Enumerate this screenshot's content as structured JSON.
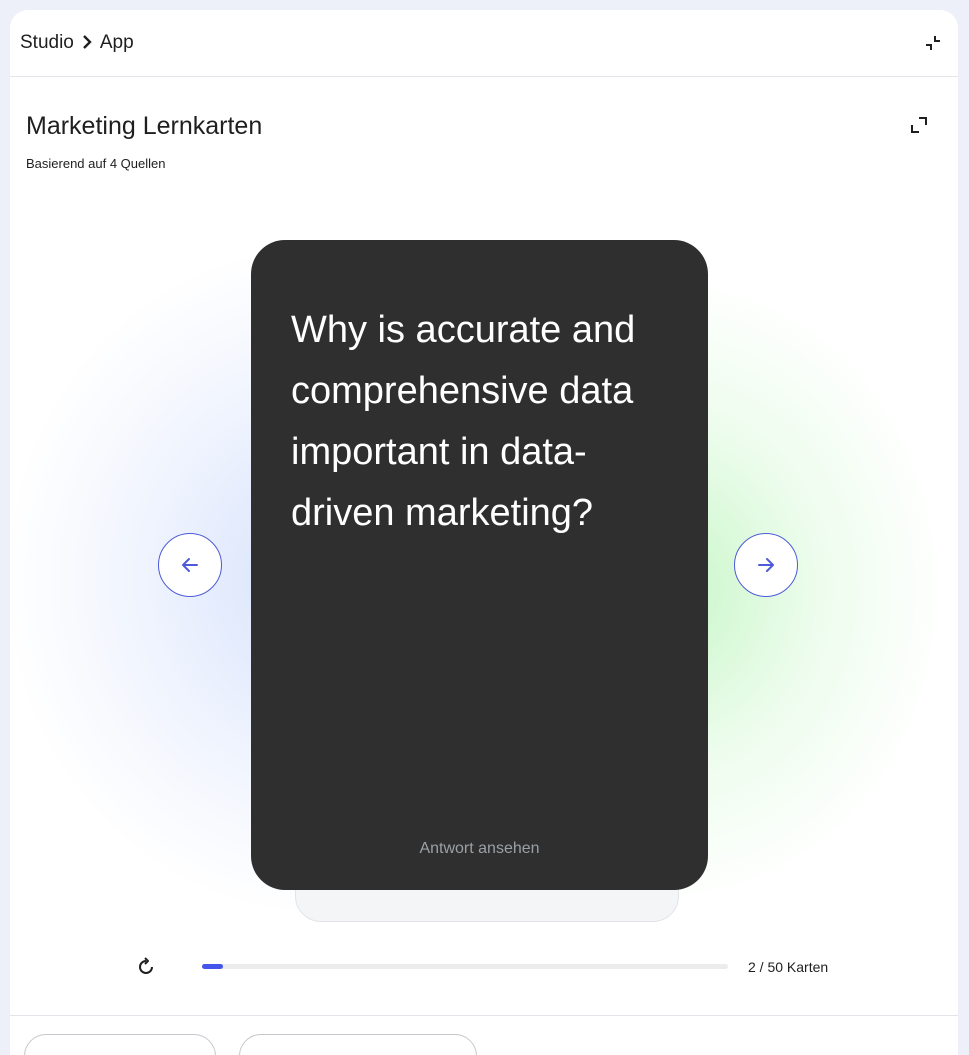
{
  "breadcrumb": {
    "studio": "Studio",
    "separator": "›",
    "app": "App"
  },
  "flashcards": {
    "title": "Marketing Lernkarten",
    "subtitle": "Basierend auf 4 Quellen",
    "question": "Why is accurate and comprehensive data important in data-driven marketing?",
    "reveal_label": "Antwort ansehen",
    "current": 2,
    "total": 50,
    "progress_fraction": 0.04,
    "counter_label": "2 / 50 Karten"
  },
  "icons": {
    "collapse": "collapse-icon",
    "expand": "fullscreen-icon",
    "prev": "arrow-left-icon",
    "next": "arrow-right-icon",
    "reset": "restart-icon"
  },
  "colors": {
    "accent": "#4355ea",
    "card": "#2f2f2f",
    "nav_border": "#4d5bd8"
  }
}
